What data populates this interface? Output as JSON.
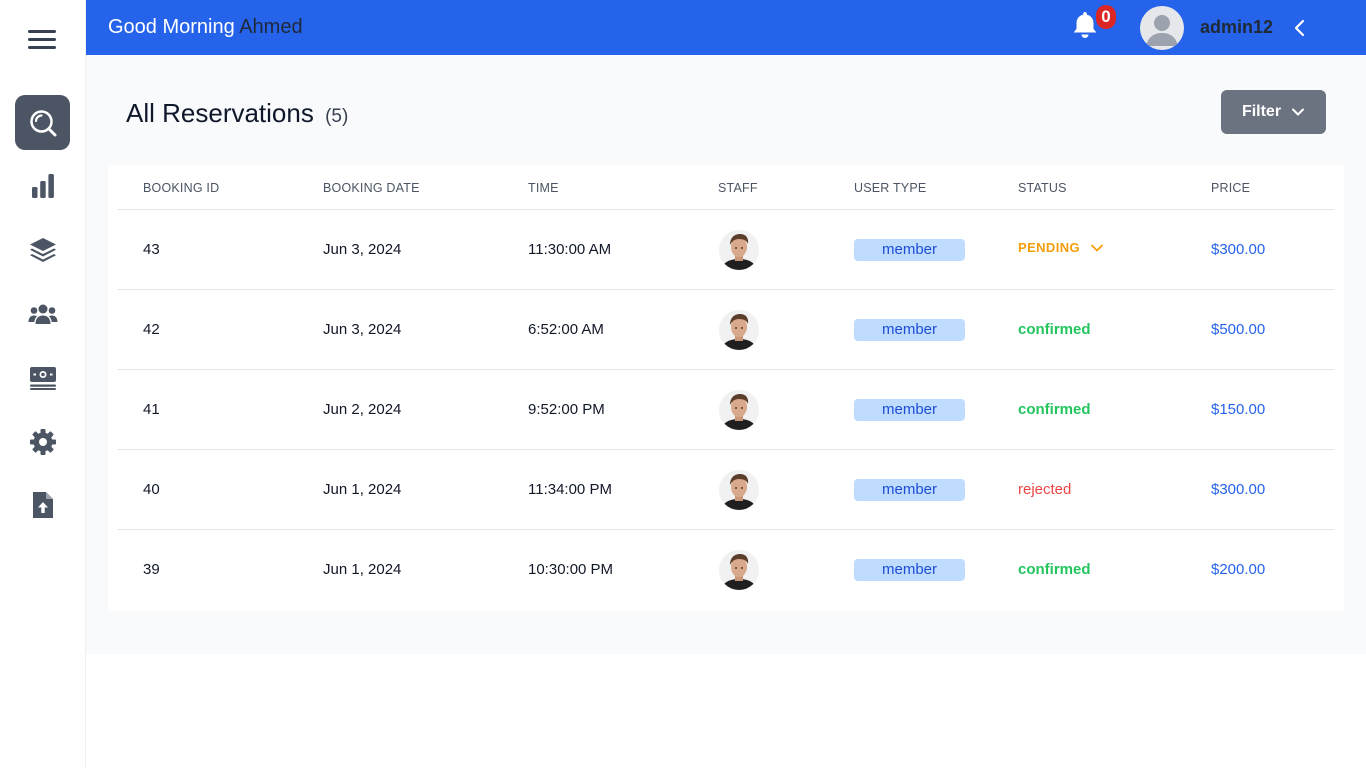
{
  "header": {
    "greeting": "Good Morning",
    "user_first_name": "Ahmed",
    "notification_count": "0",
    "username": "admin12"
  },
  "sidebar": {
    "items": [
      {
        "icon": "search-icon",
        "active": true
      },
      {
        "icon": "bar-chart-icon",
        "active": false
      },
      {
        "icon": "layers-icon",
        "active": false
      },
      {
        "icon": "users-icon",
        "active": false
      },
      {
        "icon": "money-icon",
        "active": false
      },
      {
        "icon": "gear-icon",
        "active": false
      },
      {
        "icon": "file-upload-icon",
        "active": false
      }
    ]
  },
  "page": {
    "title": "All Reservations",
    "count": "(5)",
    "filter_label": "Filter"
  },
  "table": {
    "columns": [
      "BOOKING ID",
      "BOOKING DATE",
      "TIME",
      "STAFF",
      "USER TYPE",
      "STATUS",
      "PRICE"
    ],
    "rows": [
      {
        "id": "43",
        "date": "Jun 3, 2024",
        "time": "11:30:00 AM",
        "user_type": "member",
        "status": "PENDING",
        "price": "$300.00"
      },
      {
        "id": "42",
        "date": "Jun 3, 2024",
        "time": "6:52:00 AM",
        "user_type": "member",
        "status": "confirmed",
        "price": "$500.00"
      },
      {
        "id": "41",
        "date": "Jun 2, 2024",
        "time": "9:52:00 PM",
        "user_type": "member",
        "status": "confirmed",
        "price": "$150.00"
      },
      {
        "id": "40",
        "date": "Jun 1, 2024",
        "time": "11:34:00 PM",
        "user_type": "member",
        "status": "rejected",
        "price": "$300.00"
      },
      {
        "id": "39",
        "date": "Jun 1, 2024",
        "time": "10:30:00 PM",
        "user_type": "member",
        "status": "confirmed",
        "price": "$200.00"
      }
    ]
  },
  "colors": {
    "primary": "#2563eb",
    "pending": "#f59e0b",
    "confirmed": "#22c55e",
    "rejected": "#ef4444",
    "badge_bg": "#bfdbfe"
  }
}
